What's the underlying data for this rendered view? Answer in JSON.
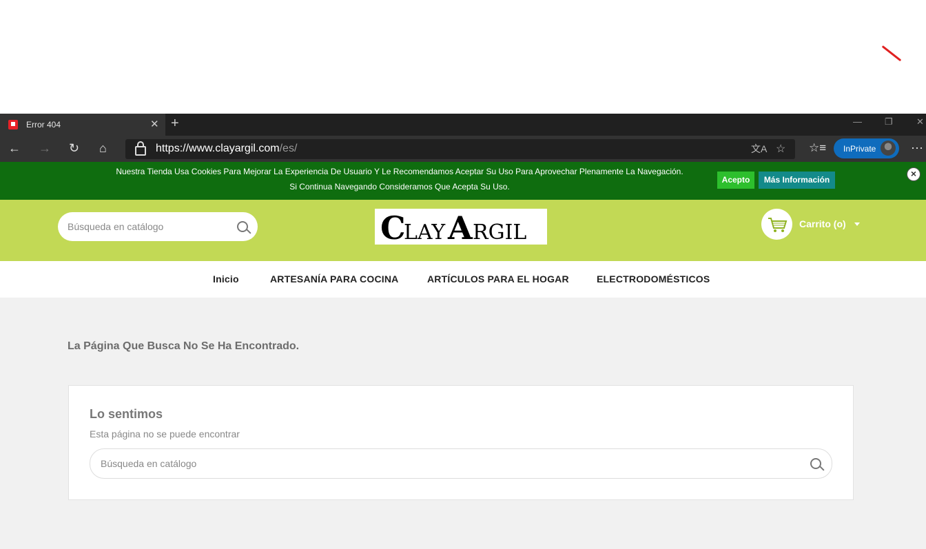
{
  "browser": {
    "tab_title": "Error 404",
    "new_tab": "+",
    "url_host": "https://www.clayargil.com",
    "url_path": "/es/",
    "inprivate_label": "InPrivate"
  },
  "cookie_banner": {
    "line1": "Nuestra Tienda Usa Cookies Para Mejorar La Experiencia De Usuario Y Le Recomendamos Aceptar Su Uso Para Aprovechar Plenamente La Navegación.",
    "line2": "Si Continua Navegando Consideramos Que Acepta Su Uso.",
    "accept_label": "Acepto",
    "more_label": "Más Información",
    "close_label": "×",
    "bg_color": "#0f6d0f"
  },
  "header": {
    "search_placeholder": "Búsqueda en catálogo",
    "logo_text": "CLAYARGIL",
    "cart_label": "Carrito (o)",
    "bg_color": "#c2d955"
  },
  "menu": {
    "items": [
      {
        "label": "Inicio"
      },
      {
        "label": "ARTESANÍA PARA COCINA"
      },
      {
        "label": "ARTÍCULOS PARA EL HOGAR"
      },
      {
        "label": "ELECTRODOMÉSTICOS"
      }
    ]
  },
  "content": {
    "heading": "La Página Que Busca No Se Ha Encontrado.",
    "card_title": "Lo sentimos",
    "card_subtitle": "Esta página no se puede encontrar",
    "search_placeholder": "Búsqueda en catálogo"
  },
  "icons": [
    "favicon-icon",
    "close-icon",
    "back-icon",
    "forward-icon",
    "refresh-icon",
    "home-icon",
    "lock-icon",
    "translate-icon",
    "star-icon",
    "favorites-icon",
    "more-icon",
    "search-icon",
    "cart-icon",
    "chevron-down-icon"
  ]
}
